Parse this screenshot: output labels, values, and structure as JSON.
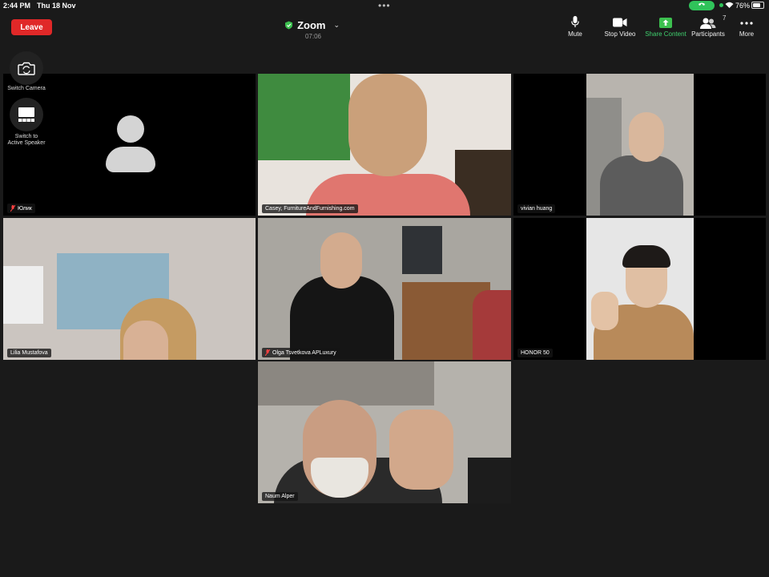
{
  "status_bar": {
    "time": "2:44 PM",
    "date": "Thu 18 Nov",
    "battery_percent_text": "76%",
    "battery_level": 0.76
  },
  "header": {
    "leave_label": "Leave",
    "title": "Zoom",
    "timer": "07:06"
  },
  "toolbar": {
    "mute_label": "Mute",
    "stop_video_label": "Stop Video",
    "share_content_label": "Share Content",
    "participants_label": "Participants",
    "participants_count": "7",
    "more_label": "More"
  },
  "side_controls": {
    "switch_camera_label": "Switch Camera",
    "active_speaker_label_line1": "Switch to",
    "active_speaker_label_line2": "Active Speaker"
  },
  "participants": [
    {
      "name": "Юлик",
      "muted": true,
      "video": false
    },
    {
      "name": "Casey, FurnitureAndFurnishing.com",
      "muted": false,
      "video": true
    },
    {
      "name": "vivian huang",
      "muted": false,
      "video": true
    },
    {
      "name": "Lilia Mustafova",
      "muted": false,
      "video": true,
      "active_speaker": true
    },
    {
      "name": "Olga Tsvetkova APLuxury",
      "muted": true,
      "video": true
    },
    {
      "name": "HONOR 50",
      "muted": false,
      "video": true
    },
    {
      "name": "Naum Alper",
      "muted": false,
      "video": true
    }
  ],
  "colors": {
    "background": "#1a1a1a",
    "leave_red": "#e02828",
    "accent_green": "#3cc04f"
  }
}
